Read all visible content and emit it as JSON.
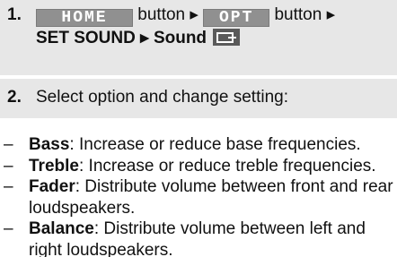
{
  "steps": [
    {
      "number": "1.",
      "home_key": "HOME",
      "home_suffix": " button ▸ ",
      "opt_key": "OPT",
      "opt_suffix": " button ▸",
      "path": "SET SOUND ▸ Sound",
      "icon": "display-tile-icon"
    },
    {
      "number": "2.",
      "text": "Select option and change setting:"
    }
  ],
  "options": [
    {
      "dash": "–",
      "term": "Bass",
      "desc": ": Increase or reduce base frequencies."
    },
    {
      "dash": "–",
      "term": "Treble",
      "desc": ": Increase or reduce treble frequencies."
    },
    {
      "dash": "–",
      "term": "Fader",
      "desc": ": Distribute volume between front and rear loudspeakers."
    },
    {
      "dash": "–",
      "term": "Balance",
      "desc": ": Distribute volume between left and right loudspeakers."
    }
  ]
}
